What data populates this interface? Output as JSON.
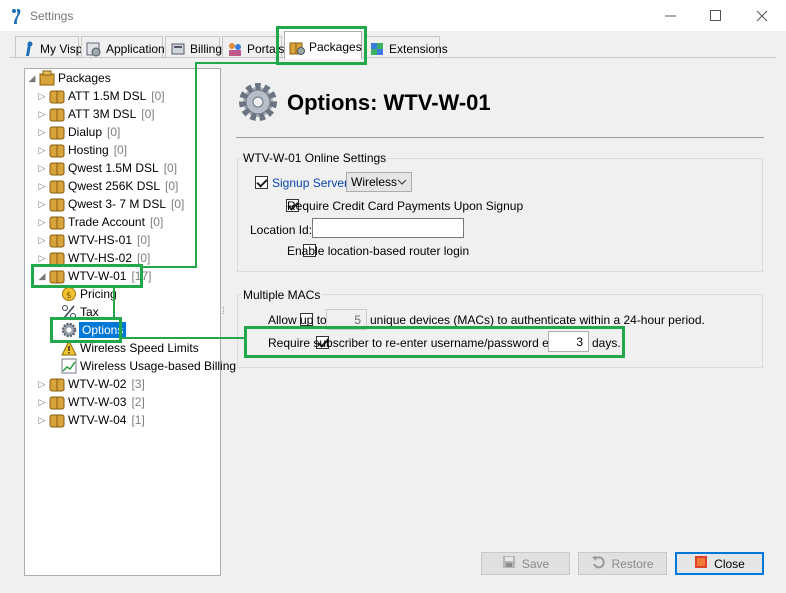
{
  "window": {
    "title": "Settings"
  },
  "tabs": [
    {
      "label": "My Visp",
      "icon": "tools-icon"
    },
    {
      "label": "Application",
      "icon": "app-gear-icon"
    },
    {
      "label": "Billing",
      "icon": "billing-icon"
    },
    {
      "label": "Portals",
      "icon": "portals-icon"
    },
    {
      "label": "Packages",
      "icon": "packages-icon",
      "selected": true
    },
    {
      "label": "Extensions",
      "icon": "puzzle-icon"
    }
  ],
  "tree": {
    "root": "Packages",
    "items": [
      {
        "label": "ATT 1.5M DSL",
        "count": "[0]"
      },
      {
        "label": "ATT 3M DSL",
        "count": "[0]"
      },
      {
        "label": "Dialup",
        "count": "[0]"
      },
      {
        "label": "Hosting",
        "count": "[0]"
      },
      {
        "label": "Qwest 1.5M DSL",
        "count": "[0]"
      },
      {
        "label": "Qwest 256K DSL",
        "count": "[0]"
      },
      {
        "label": "Qwest 3- 7 M DSL",
        "count": "[0]"
      },
      {
        "label": "Trade Account",
        "count": "[0]"
      },
      {
        "label": "WTV-HS-01",
        "count": "[0]"
      },
      {
        "label": "WTV-HS-02",
        "count": "[0]"
      },
      {
        "label": "WTV-W-01",
        "count": "[17]"
      },
      {
        "label": "WTV-W-02",
        "count": "[3]"
      },
      {
        "label": "WTV-W-03",
        "count": "[2]"
      },
      {
        "label": "WTV-W-04",
        "count": "[1]"
      }
    ],
    "children": [
      {
        "label": "Pricing",
        "icon": "coins-icon"
      },
      {
        "label": "Tax",
        "icon": "percent-icon"
      },
      {
        "label": "Options",
        "icon": "gear-icon",
        "selected": true
      },
      {
        "label": "Wireless Speed Limits",
        "icon": "warning-icon"
      },
      {
        "label": "Wireless Usage-based Billing",
        "icon": "chart-icon"
      }
    ]
  },
  "header": {
    "title": "Options: WTV-W-01"
  },
  "online": {
    "legend": "WTV-W-01 Online Settings",
    "signup_label": "Signup Server:",
    "signup_value": "Wireless",
    "require_cc_label": "Require Credit Card Payments Upon Signup",
    "location_label": "Location Id:",
    "location_value": "",
    "location_login_label": "Enable location-based router login"
  },
  "macs": {
    "legend": "Multiple MACs",
    "allow_label": "Allow up to",
    "allow_value": "5",
    "allow_suffix": "unique devices (MACs) to authenticate within a 24-hour period.",
    "reenter_label": "Require subscriber to re-enter username/password every",
    "reenter_value": "3",
    "reenter_suffix": "days."
  },
  "buttons": {
    "save": "Save",
    "restore": "Restore",
    "close": "Close"
  },
  "colors": {
    "highlight": "#22a84a",
    "selection": "#0078d7",
    "link": "#0645ad"
  }
}
